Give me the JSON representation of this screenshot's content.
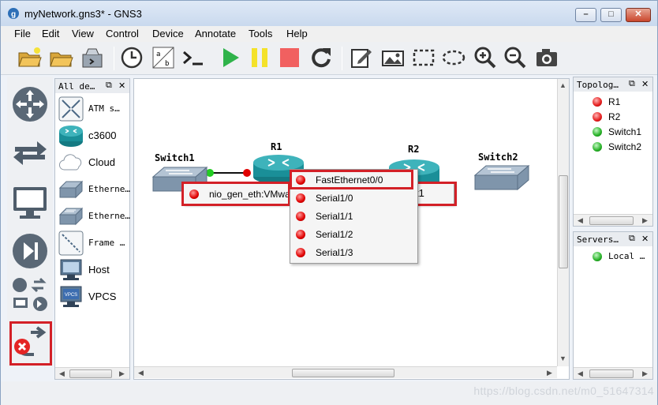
{
  "window": {
    "title": "myNetwork.gns3* - GNS3",
    "minimize": "0",
    "maximize": "1",
    "close": "r"
  },
  "menu": [
    "File",
    "Edit",
    "View",
    "Control",
    "Device",
    "Annotate",
    "Tools",
    "Help"
  ],
  "toolbar_icons": [
    "open-project-icon",
    "open-folder-icon",
    "snapshot-icon",
    "timer-icon",
    "console-all-icon",
    "terminal-icon",
    "start-icon",
    "pause-icon",
    "stop-icon",
    "reload-icon",
    "add-note-icon",
    "insert-image-icon",
    "draw-rectangle-icon",
    "draw-ellipse-icon",
    "zoom-in-icon",
    "zoom-out-icon",
    "screenshot-icon"
  ],
  "devices_panel": {
    "title": "All de…",
    "items": [
      {
        "label": "ATM s…",
        "icon": "atm-switch-icon"
      },
      {
        "label": "c3600",
        "icon": "router-icon"
      },
      {
        "label": "Cloud",
        "icon": "cloud-icon"
      },
      {
        "label": "Etherne…",
        "icon": "ethernet-hub-icon"
      },
      {
        "label": "Etherne…",
        "icon": "ethernet-switch-icon"
      },
      {
        "label": "Frame …",
        "icon": "frame-relay-icon"
      },
      {
        "label": "Host",
        "icon": "host-icon"
      },
      {
        "label": "VPCS",
        "icon": "vpcs-icon"
      }
    ]
  },
  "canvas": {
    "nodes": {
      "switch1": "Switch1",
      "r1": "R1",
      "r2": "R2",
      "switch2": "Switch2"
    },
    "r1_menu_partial": "nio_gen_eth:VMwa",
    "r2_menu_partial": "t1",
    "interface_menu": [
      "FastEthernet0/0",
      "Serial1/0",
      "Serial1/1",
      "Serial1/2",
      "Serial1/3"
    ]
  },
  "topology_panel": {
    "title": "Topolog…",
    "nodes": [
      {
        "name": "R1",
        "status": "red"
      },
      {
        "name": "R2",
        "status": "red"
      },
      {
        "name": "Switch1",
        "status": "green"
      },
      {
        "name": "Switch2",
        "status": "green"
      }
    ]
  },
  "servers_panel": {
    "title": "Servers…",
    "items": [
      "Local …"
    ]
  },
  "watermark": "https://blog.csdn.net/m0_51647314",
  "colors": {
    "highlight": "#d32027",
    "link_up": "#22cc22",
    "link_down": "#e00000"
  }
}
